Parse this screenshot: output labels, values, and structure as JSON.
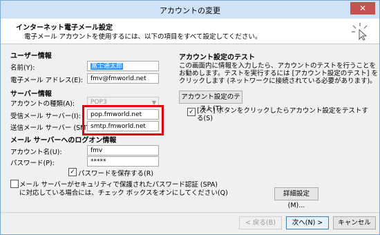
{
  "window": {
    "title": "アカウントの変更",
    "close_glyph": "✕"
  },
  "header": {
    "title": "インターネット電子メール設定",
    "subtitle": "電子メール アカウントを使用するには、以下の項目をすべて設定してください。"
  },
  "user_info": {
    "section": "ユーザー情報",
    "name_label": "名前(Y):",
    "name_value": "富士通太郎",
    "email_label": "電子メール アドレス(E):",
    "email_value": "fmv@fmworld.net"
  },
  "server_info": {
    "section": "サーバー情報",
    "account_type_label": "アカウントの種類(A):",
    "account_type_value": "POP3",
    "incoming_label": "受信メール サーバー(I):",
    "incoming_value": "pop.fmworld.net",
    "outgoing_label": "送信メール サーバー (SMTP)(O):",
    "outgoing_value": "smtp.fmworld.net"
  },
  "logon_info": {
    "section": "メール サーバーへのログオン情報",
    "account_label": "アカウント名(U):",
    "account_value": "fmv",
    "password_label": "パスワード(P):",
    "password_value": "*****",
    "remember_label": "パスワードを保存する(R)",
    "remember_checked": true,
    "spa_label_line1": "メール サーバーがセキュリティで保護されたパスワード認証 (SPA)",
    "spa_label_line2": "に対応している場合には、チェック ボックスをオンにしてください(Q)",
    "spa_checked": false
  },
  "test": {
    "section": "アカウント設定のテスト",
    "desc_line1": "この画面内に情報を入力したら、アカウントのテストを行うことを",
    "desc_line2": "お勧めします。テストを実行するには [アカウント設定のテスト] を",
    "desc_line3": "クリックします (ネットワークに接続されている必要があります)。",
    "test_button": "アカウント設定のテスト(T)",
    "auto_test_line1": "[次へ] ボタンをクリックしたらアカウント設定をテストす",
    "auto_test_line2": "る(S)",
    "auto_test_checked": true
  },
  "buttons": {
    "more_settings": "詳細設定(M)...",
    "back": "< 戻る(B)",
    "next": "次へ(N) >",
    "cancel": "キャンセル"
  },
  "colors": {
    "highlight_box": "#e60012",
    "selection": "#3399ff"
  }
}
